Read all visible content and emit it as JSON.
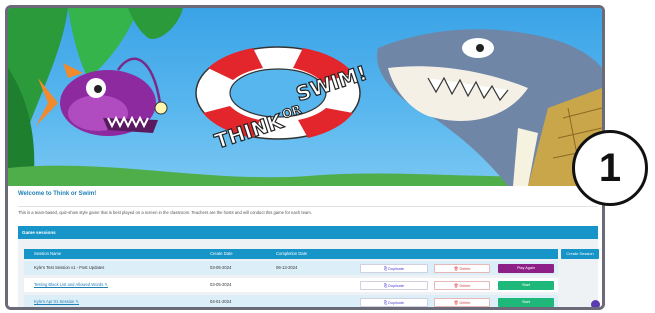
{
  "banner": {
    "logo_text_1": "THINK",
    "logo_text_2": "OR",
    "logo_text_3": "SWIM!"
  },
  "intro": {
    "title": "Welcome to Think or Swim!",
    "description": "This is a team-based, quiz-show style game that is best played on a screen in the classroom. Teachers are the hosts and will conduct this game for each team."
  },
  "sessions": {
    "panel_title": "Game sessions",
    "create_label": "Create Session",
    "columns": [
      "Session Name",
      "Create Date",
      "Completion Date"
    ],
    "rows": [
      {
        "name": "Kyle's Test Session v1 - Post Updates",
        "create": "03-05-2024",
        "complete": "06-13-2024",
        "action": "Play Again",
        "linked": false
      },
      {
        "name": "Testing Black List and Allowed Words",
        "create": "03-05-2024",
        "complete": "",
        "action": "Start",
        "linked": true
      },
      {
        "name": "Kyle's Apr 01 Session",
        "create": "04-01-2024",
        "complete": "",
        "action": "Start",
        "linked": true
      }
    ],
    "duplicate_label": "Duplicate",
    "delete_label": "Delete"
  },
  "annotation": {
    "number": "1"
  },
  "colors": {
    "accent": "#1795c8",
    "play_again": "#8e1f86",
    "start": "#1fb87b",
    "delete": "#d44848"
  }
}
